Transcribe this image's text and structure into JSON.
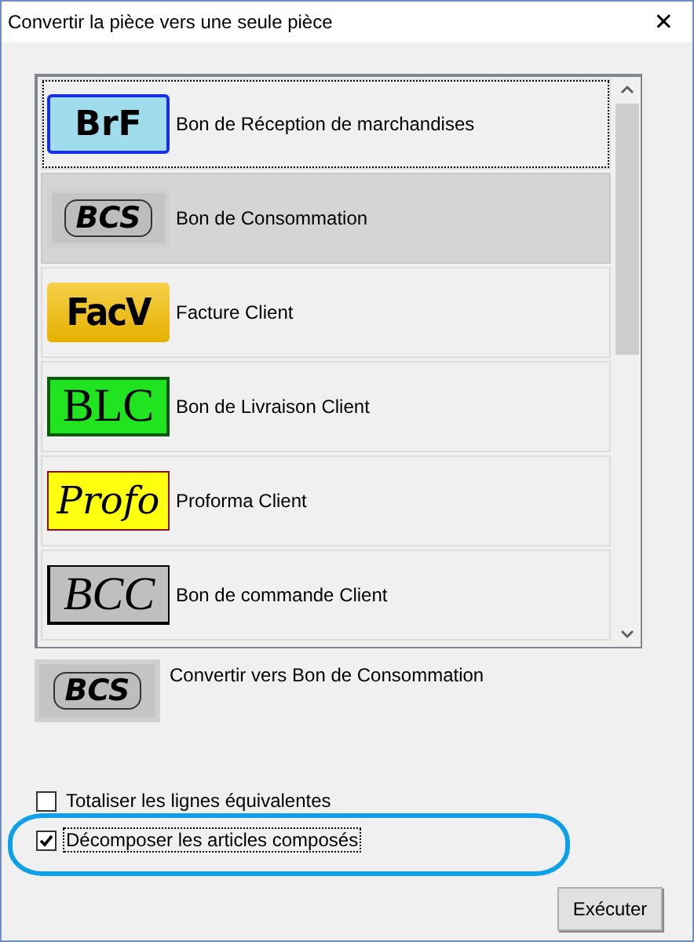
{
  "window": {
    "title": "Convertir la pièce vers une seule pièce",
    "close": "✕"
  },
  "list": {
    "items": [
      {
        "kind": "brf",
        "logo": "BrF",
        "label": "Bon de Réception de marchandises",
        "selected": false,
        "focused": true
      },
      {
        "kind": "bcs",
        "logo": "BCS",
        "label": "Bon de Consommation",
        "selected": true,
        "focused": false
      },
      {
        "kind": "facv",
        "logo": "FacV",
        "label": "Facture Client",
        "selected": false,
        "focused": false
      },
      {
        "kind": "blc",
        "logo": "BLC",
        "label": "Bon de Livraison Client",
        "selected": false,
        "focused": false
      },
      {
        "kind": "profo",
        "logo": "Profo",
        "label": "Proforma Client",
        "selected": false,
        "focused": false
      },
      {
        "kind": "bcc",
        "logo": "BCC",
        "label": "Bon de commande Client",
        "selected": false,
        "focused": false
      }
    ]
  },
  "target": {
    "kind": "bcs",
    "logo": "BCS",
    "label": "Convertir vers Bon de Consommation"
  },
  "options": [
    {
      "label": "Totaliser les lignes équivalentes",
      "checked": false,
      "focused": false,
      "highlighted": false
    },
    {
      "label": "Décomposer les articles composés",
      "checked": true,
      "focused": true,
      "highlighted": true
    }
  ],
  "buttons": [
    {
      "label": "Exécuter"
    }
  ]
}
